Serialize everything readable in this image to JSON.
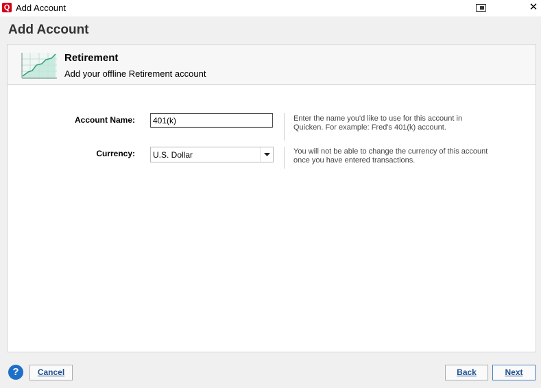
{
  "window": {
    "app_icon_letter": "Q",
    "title": "Add Account"
  },
  "page": {
    "title": "Add Account"
  },
  "header": {
    "title": "Retirement",
    "subtitle": "Add your offline Retirement account"
  },
  "form": {
    "account_name": {
      "label": "Account Name:",
      "value": "401(k)",
      "help": "Enter the name you'd like to use for this account in Quicken. For example: Fred's 401(k) account."
    },
    "currency": {
      "label": "Currency:",
      "value": "U.S. Dollar",
      "help": "You will not be able to change the currency of this account once you have entered transactions."
    }
  },
  "footer": {
    "help_label": "?",
    "cancel_label": "Cancel",
    "back_label": "Back",
    "next_label": "Next"
  },
  "colors": {
    "accent": "#1e6fc7",
    "brand": "#d4001a",
    "button_text": "#1f4f8f"
  }
}
